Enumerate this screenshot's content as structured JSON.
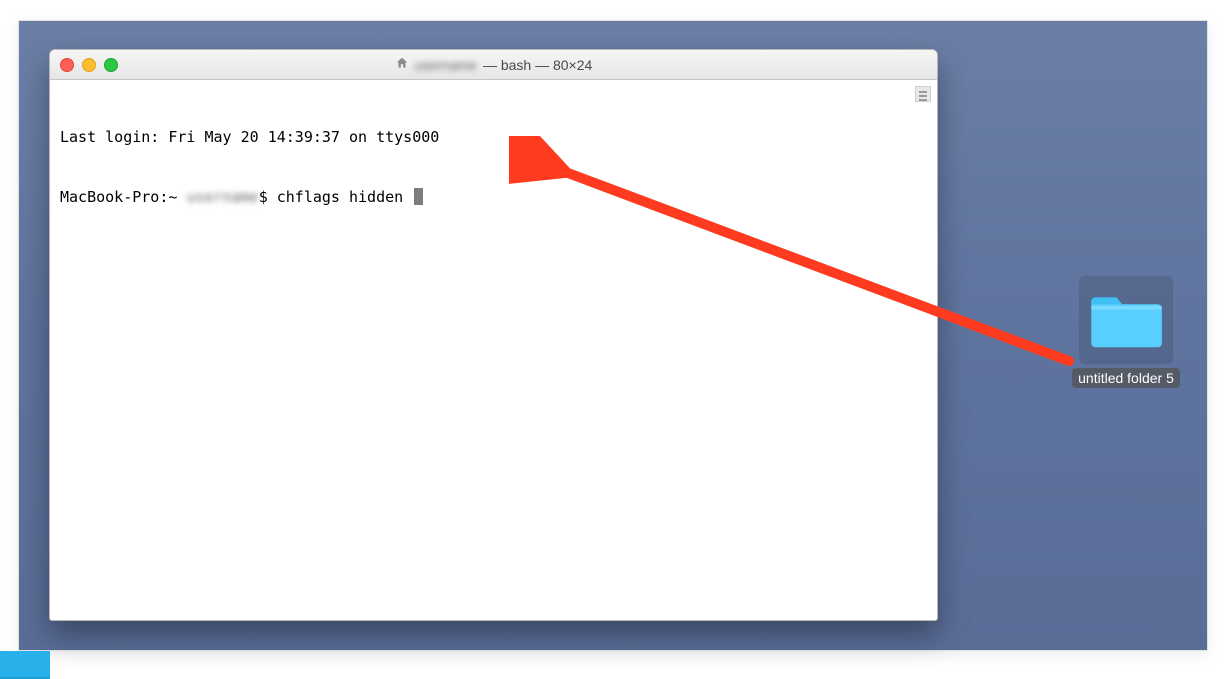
{
  "window": {
    "home_icon_label": "home-icon",
    "title_user": "username",
    "title_suffix": " — bash — 80×24"
  },
  "terminal": {
    "line1": "Last login: Fri May 20 14:39:37 on ttys000",
    "prompt_prefix": "MacBook-Pro:~ ",
    "prompt_user": "username",
    "prompt_symbol": "$ ",
    "typed_command": "chflags hidden "
  },
  "desktop_item": {
    "label": "untitled folder 5"
  },
  "colors": {
    "arrow": "#ff3b1f",
    "folder_fill": "#59cfff",
    "folder_tab": "#3fbff5"
  }
}
